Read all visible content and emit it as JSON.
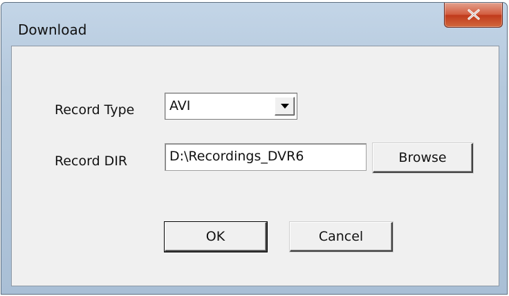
{
  "window": {
    "title": "Download",
    "close_label": "X"
  },
  "form": {
    "record_type_label": "Record Type",
    "record_type_value": "AVI",
    "record_dir_label": "Record DIR",
    "record_dir_value": "D:\\Recordings_DVR6"
  },
  "buttons": {
    "browse": "Browse",
    "ok": "OK",
    "cancel": "Cancel"
  },
  "colors": {
    "close_button": "#c84a2c",
    "client_background": "#f0f0f0",
    "frame": "#b4c8dc"
  },
  "icons": {
    "close": "close-icon",
    "dropdown": "chevron-down-icon"
  }
}
